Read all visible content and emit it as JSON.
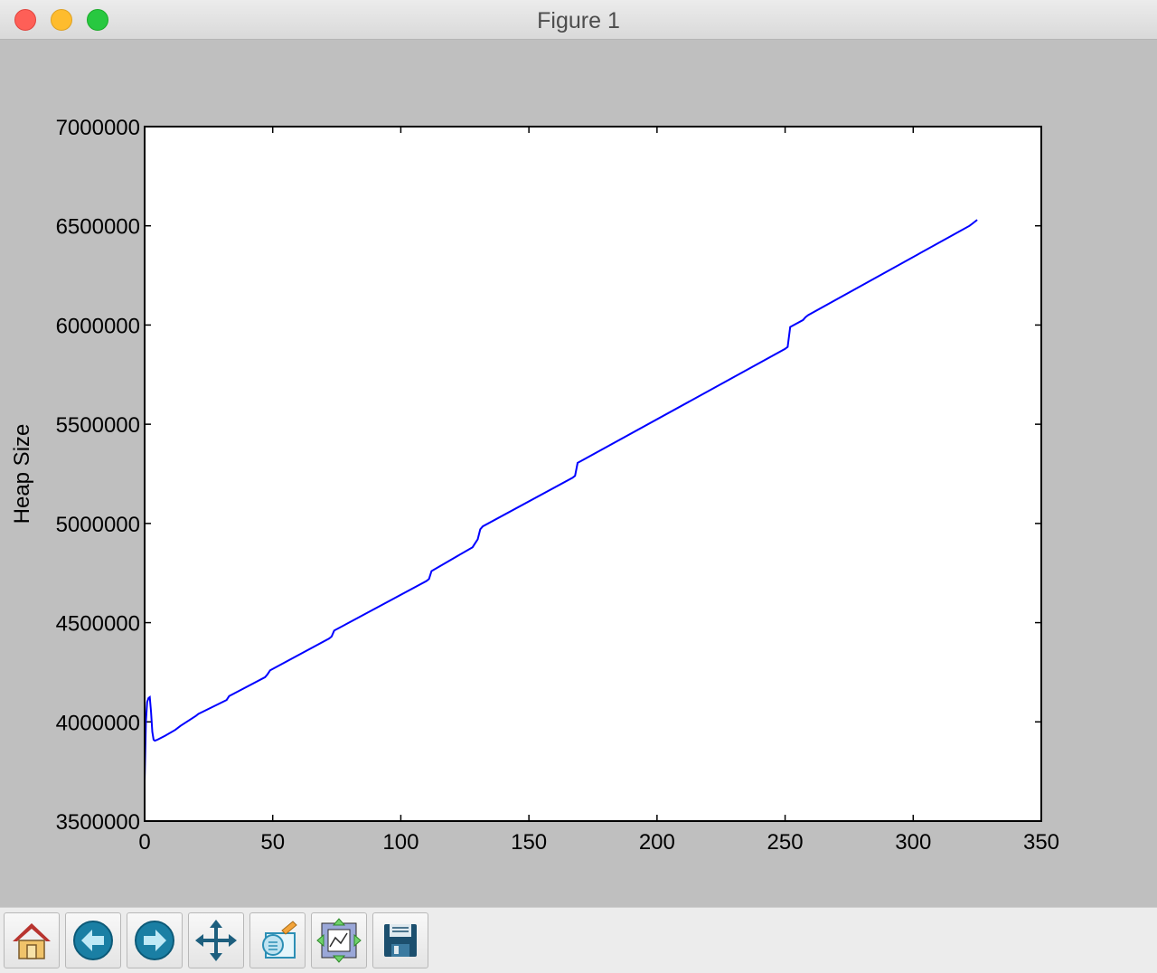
{
  "window": {
    "title": "Figure 1"
  },
  "toolbar": {
    "buttons": [
      {
        "name": "home-icon",
        "tooltip": "Reset original view"
      },
      {
        "name": "back-arrow-icon",
        "tooltip": "Back to previous view"
      },
      {
        "name": "forward-arrow-icon",
        "tooltip": "Forward to next view"
      },
      {
        "name": "pan-move-icon",
        "tooltip": "Pan axes"
      },
      {
        "name": "zoom-rect-icon",
        "tooltip": "Zoom to rectangle"
      },
      {
        "name": "subplots-config-icon",
        "tooltip": "Configure subplots"
      },
      {
        "name": "save-floppy-icon",
        "tooltip": "Save the figure"
      }
    ]
  },
  "colors": {
    "figure_bg": "#bfbfbf",
    "axes_bg": "#ffffff",
    "line": "#0000ff"
  },
  "chart_data": {
    "type": "line",
    "title": "",
    "xlabel": "",
    "ylabel": "Heap Size",
    "xlim": [
      0,
      350
    ],
    "ylim": [
      3500000,
      7000000
    ],
    "xticks": [
      0,
      50,
      100,
      150,
      200,
      250,
      300,
      350
    ],
    "yticks": [
      3500000,
      4000000,
      4500000,
      5000000,
      5500000,
      6000000,
      6500000,
      7000000
    ],
    "xtick_labels": [
      "0",
      "50",
      "100",
      "150",
      "200",
      "250",
      "300",
      "350"
    ],
    "ytick_labels": [
      "3500000",
      "4000000",
      "4500000",
      "5000000",
      "5500000",
      "6000000",
      "6500000",
      "7000000"
    ],
    "grid": false,
    "series": [
      {
        "x": [
          0,
          0.5,
          1,
          1.5,
          2,
          2.5,
          3,
          3.5,
          4,
          5,
          8,
          12,
          14,
          20,
          21,
          32,
          33,
          47,
          48,
          49,
          72,
          73,
          74,
          110,
          111,
          112,
          128,
          129,
          130,
          131,
          132,
          167,
          168,
          169,
          250,
          251,
          252,
          257,
          258,
          259,
          322,
          323,
          325
        ],
        "y": [
          3700000,
          4000000,
          4100000,
          4120000,
          4125000,
          4050000,
          3950000,
          3910000,
          3905000,
          3910000,
          3930000,
          3960000,
          3980000,
          4030000,
          4040000,
          4110000,
          4130000,
          4225000,
          4240000,
          4260000,
          4420000,
          4430000,
          4460000,
          4710000,
          4720000,
          4760000,
          4880000,
          4900000,
          4920000,
          4970000,
          4985000,
          5230000,
          5240000,
          5305000,
          5880000,
          5890000,
          5990000,
          6025000,
          6040000,
          6050000,
          6500000,
          6510000,
          6530000
        ]
      }
    ]
  }
}
